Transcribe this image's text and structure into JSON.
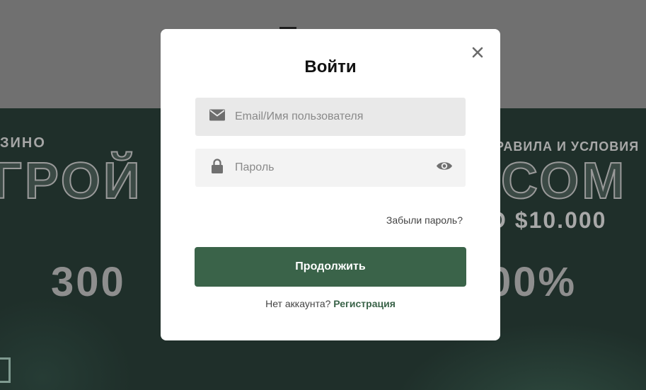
{
  "background": {
    "top_left_small": "ЗИНО",
    "top_left_big": "ГРОЙ",
    "top_right_small": "РАВИЛА И УСЛОВИЯ",
    "top_right_big": "СОМ",
    "mid_right": "О $10.000",
    "big_left": "300",
    "big_right": "00%"
  },
  "modal": {
    "title": "Войти",
    "close_icon": "close-icon",
    "email": {
      "icon": "envelope-icon",
      "placeholder": "Email/Имя пользователя",
      "value": ""
    },
    "password": {
      "icon": "lock-icon",
      "toggle_icon": "eye-icon",
      "placeholder": "Пароль",
      "value": ""
    },
    "forgot_label": "Забыли пароль?",
    "submit_label": "Продолжить",
    "no_account_text": "Нет аккаунта?",
    "register_label": "Регистрация"
  },
  "colors": {
    "accent": "#3a6349",
    "overlay": "#707070",
    "banner": "#1f2f2a"
  }
}
